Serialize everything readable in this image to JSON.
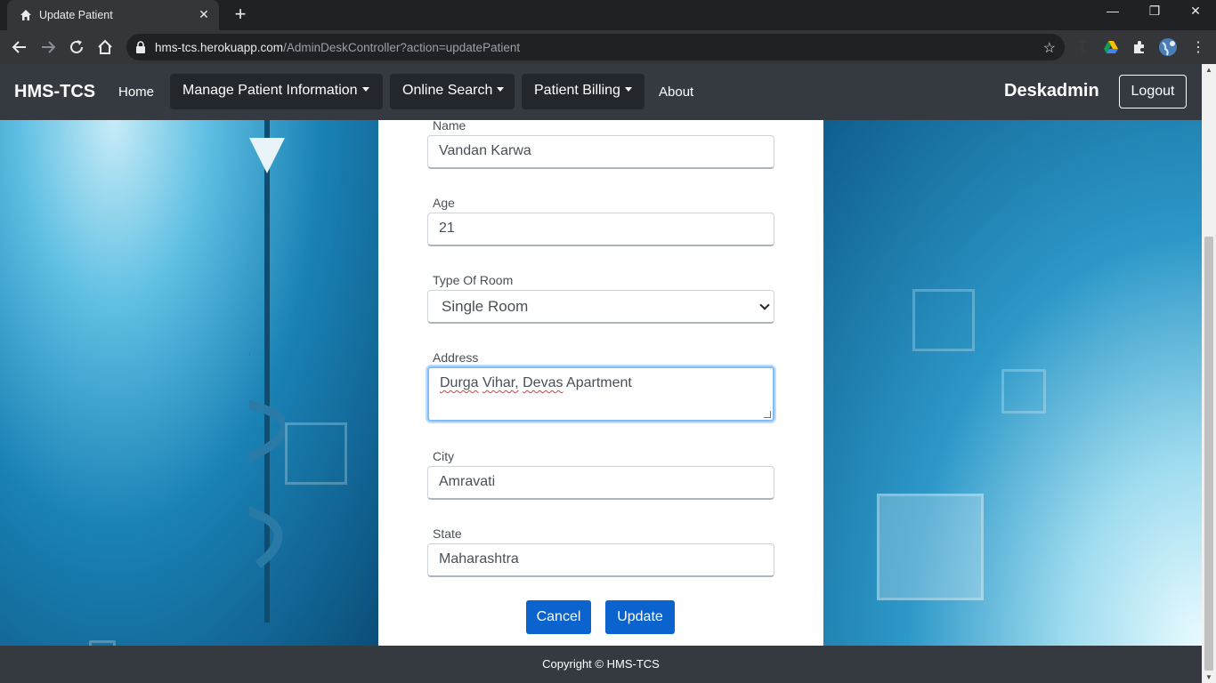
{
  "browser": {
    "tab_title": "Update Patient",
    "url_host": "hms-tcs.herokuapp.com",
    "url_path": "/AdminDeskController?action=updatePatient"
  },
  "navbar": {
    "brand": "HMS-TCS",
    "home": "Home",
    "menu_patient": "Manage Patient Information",
    "menu_search": "Online Search",
    "menu_billing": "Patient Billing",
    "about": "About",
    "user": "Deskadmin",
    "logout": "Logout"
  },
  "form": {
    "name_label": "Name",
    "name_value": "Vandan Karwa",
    "age_label": "Age",
    "age_value": "21",
    "room_label": "Type Of Room",
    "room_value": "Single Room",
    "address_label": "Address",
    "address_words": [
      "Durga",
      " ",
      "Vihar,",
      " ",
      "Devas",
      " Apartment"
    ],
    "city_label": "City",
    "city_value": "Amravati",
    "state_label": "State",
    "state_value": "Maharashtra",
    "cancel": "Cancel",
    "update": "Update"
  },
  "footer": {
    "copyright": "Copyright © HMS-TCS"
  },
  "colors": {
    "navbar": "#343a40",
    "primary_button": "#0b63ce",
    "focus_border": "#80bdff"
  },
  "icons": [
    "home-icon",
    "close-icon",
    "plus-icon",
    "back-icon",
    "forward-icon",
    "reload-icon",
    "lock-icon",
    "star-icon",
    "extension-icon",
    "drive-icon",
    "globe-icon",
    "menu-icon"
  ]
}
